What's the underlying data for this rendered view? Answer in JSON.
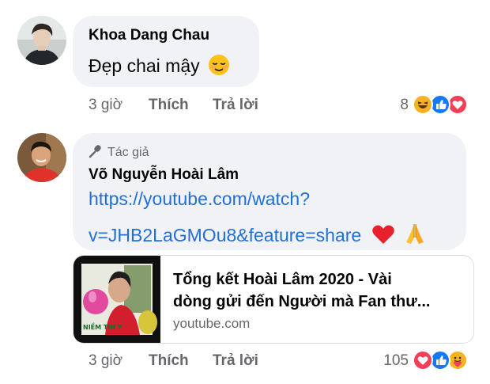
{
  "comments": [
    {
      "author": "Khoa Dang Chau",
      "text": "Đẹp chai mậy",
      "emoji_icon": "relieved-face-icon",
      "time": "3 giờ",
      "like_label": "Thích",
      "reply_label": "Trả lời",
      "reaction_count": "8",
      "reactions": [
        "haha",
        "like",
        "love"
      ]
    },
    {
      "badge": "Tác giả",
      "badge_icon": "microphone-icon",
      "author": "Võ Nguyễn Hoài Lâm",
      "link_line1": "https://youtube.com/watch?",
      "link_line2": "v=JHB2LaGMOu8&feature=share",
      "emoji_icons": [
        "red-heart-icon",
        "folded-hands-icon"
      ],
      "preview": {
        "title_line1": "Tổng kết Hoài Lâm 2020 - Vài",
        "title_line2": "dòng gửi đến Người mà Fan thư...",
        "domain": "youtube.com",
        "thumbnail_text": "NIỀM TIN Y"
      },
      "time": "3 giờ",
      "like_label": "Thích",
      "reply_label": "Trả lời",
      "reaction_count": "105",
      "reactions": [
        "love",
        "like",
        "care"
      ]
    }
  ],
  "colors": {
    "bubble": "#f0f2f5",
    "link": "#216fdb",
    "meta": "#65676b",
    "like_blue": "#1877f2",
    "love_red": "#f33e58",
    "haha_yellow": "#f7b125"
  }
}
